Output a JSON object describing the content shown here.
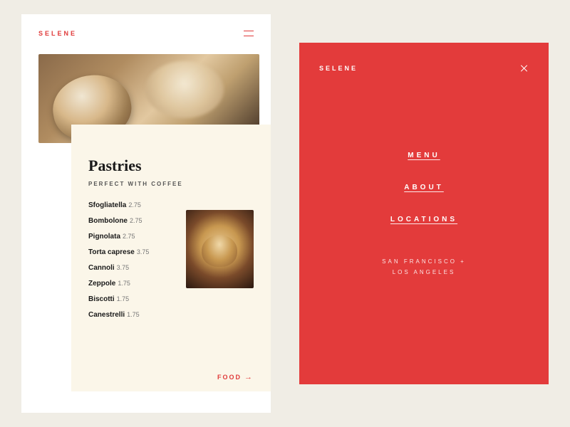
{
  "brand": "SELENE",
  "left": {
    "section_title": "Pastries",
    "section_sub": "PERFECT WITH COFFEE",
    "items": [
      {
        "name": "Sfogliatella",
        "price": "2.75"
      },
      {
        "name": "Bombolone",
        "price": "2.75"
      },
      {
        "name": "Pignolata",
        "price": "2.75"
      },
      {
        "name": "Torta caprese",
        "price": "3.75"
      },
      {
        "name": "Cannoli",
        "price": "3.75"
      },
      {
        "name": "Zeppole",
        "price": "1.75"
      },
      {
        "name": "Biscotti",
        "price": "1.75"
      },
      {
        "name": "Canestrelli",
        "price": "1.75"
      }
    ],
    "footer_link": "FOOD"
  },
  "right": {
    "nav": [
      "MENU",
      "ABOUT",
      "LOCATIONS"
    ],
    "locations_line1": "SAN FRANCISCO +",
    "locations_line2": "LOS ANGELES"
  }
}
